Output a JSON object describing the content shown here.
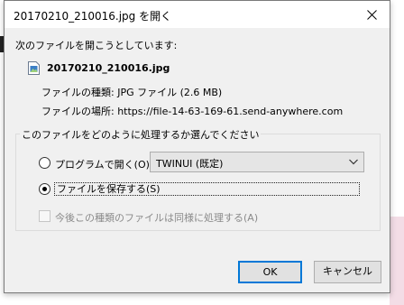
{
  "window": {
    "title": "20170210_210016.jpg を開く"
  },
  "dialog": {
    "intro": "次のファイルを開こうとしています:",
    "file_name": "20170210_210016.jpg",
    "type_line": "ファイルの種類: JPG ファイル (2.6 MB)",
    "from_line": "ファイルの場所: https://file-14-63-169-61.send-anywhere.com",
    "group_legend": "このファイルをどのように処理するか選んでください",
    "open_with_label": "プログラムで開く(O):",
    "open_with_app": "TWINUI (既定)",
    "save_label": "ファイルを保存する(S)",
    "selected_option": "save",
    "remember_label": "今後この種類のファイルは同様に処理する(A)",
    "remember_checked": false,
    "ok_label": "OK",
    "cancel_label": "キャンセル"
  },
  "icons": {
    "close": "close-icon",
    "file": "image-file-icon",
    "dropdown": "chevron-down-icon"
  },
  "colors": {
    "dialog_bg": "#f0f0f0",
    "accent": "#0078d7",
    "disabled_text": "#8a8a8a"
  }
}
